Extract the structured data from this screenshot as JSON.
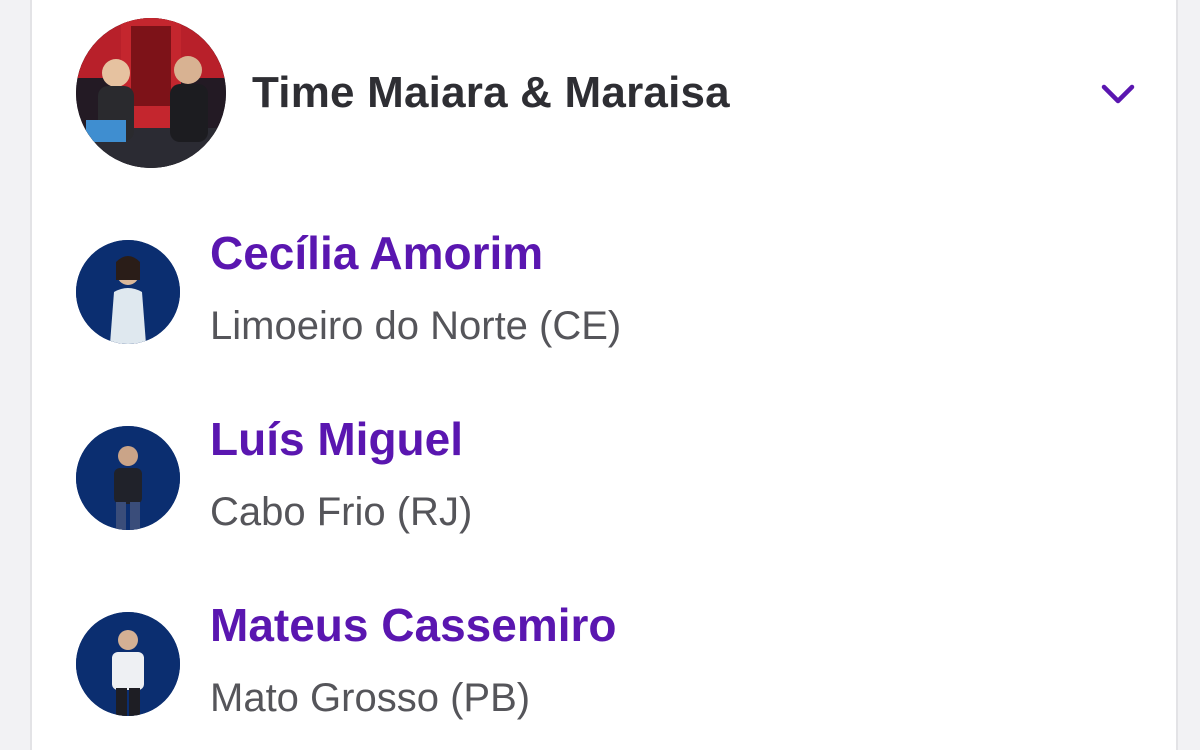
{
  "team": {
    "name": "Time Maiara & Maraisa",
    "avatar_icon": "team-photo",
    "toggle_icon": "chevron-down-icon"
  },
  "colors": {
    "accent": "#5a16b0",
    "heading": "#2e2e33",
    "secondary_text": "#55555a"
  },
  "members": [
    {
      "name": "Cecília Amorim",
      "location": "Limoeiro do Norte (CE)"
    },
    {
      "name": "Luís Miguel",
      "location": "Cabo Frio (RJ)"
    },
    {
      "name": "Mateus Cassemiro",
      "location": "Mato Grosso (PB)"
    }
  ]
}
